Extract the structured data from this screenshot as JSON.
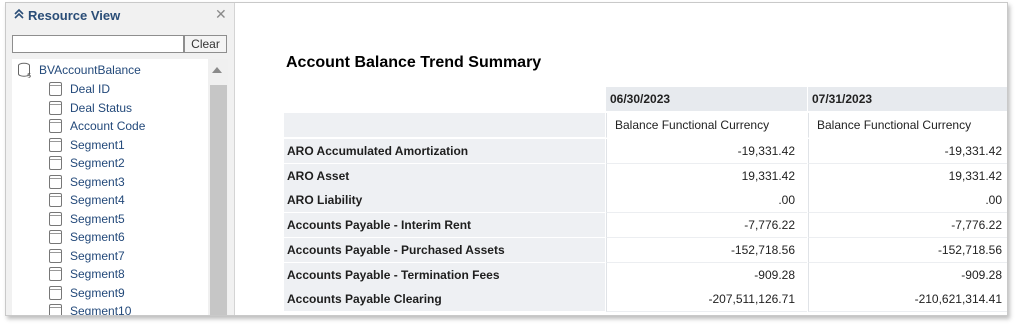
{
  "panel": {
    "title": "Resource View",
    "search": {
      "value": "",
      "placeholder": ""
    },
    "clear_label": "Clear",
    "tree": {
      "root": "BVAccountBalance",
      "items": [
        "Deal ID",
        "Deal Status",
        "Account Code",
        "Segment1",
        "Segment2",
        "Segment3",
        "Segment4",
        "Segment5",
        "Segment6",
        "Segment7",
        "Segment8",
        "Segment9",
        "Segment10"
      ]
    }
  },
  "report": {
    "title": "Account Balance Trend Summary",
    "columns": [
      {
        "date": "06/30/2023",
        "measure": "Balance Functional Currency"
      },
      {
        "date": "07/31/2023",
        "measure": "Balance Functional Currency"
      }
    ],
    "rows": [
      {
        "label": "ARO Accumulated Amortization",
        "values": [
          "-19,331.42",
          "-19,331.42"
        ]
      },
      {
        "label": "ARO Asset",
        "values": [
          "19,331.42",
          "19,331.42"
        ]
      },
      {
        "label": "ARO Liability",
        "values": [
          ".00",
          ".00"
        ]
      },
      {
        "label": "Accounts Payable - Interim Rent",
        "values": [
          "-7,776.22",
          "-7,776.22"
        ]
      },
      {
        "label": "Accounts Payable - Purchased Assets",
        "values": [
          "-152,718.56",
          "-152,718.56"
        ]
      },
      {
        "label": "Accounts Payable - Termination Fees",
        "values": [
          "-909.28",
          "-909.28"
        ]
      },
      {
        "label": "Accounts Payable Clearing",
        "values": [
          "-207,511,126.71",
          "-210,621,314.41"
        ]
      }
    ]
  }
}
